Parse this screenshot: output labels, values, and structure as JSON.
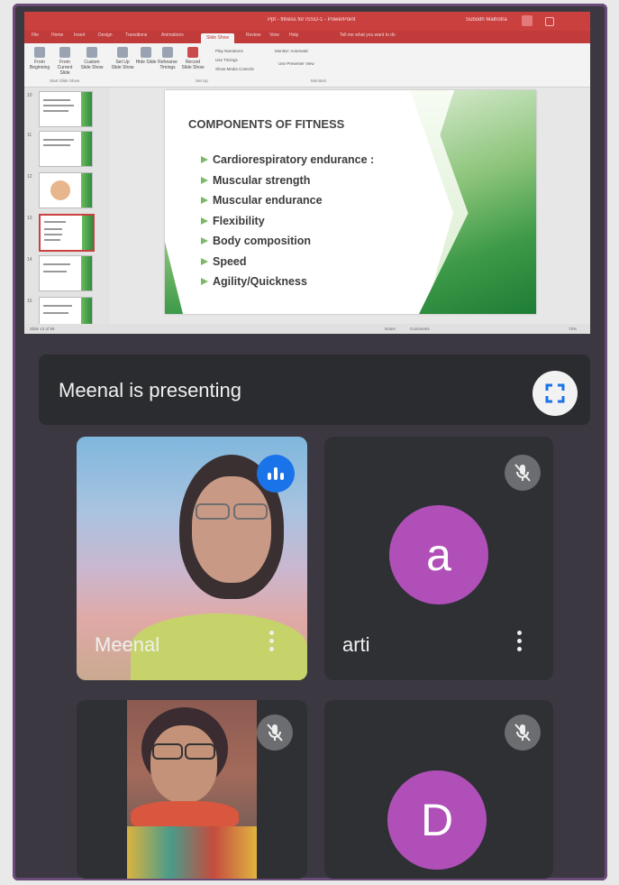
{
  "app": {
    "title": "Ppt - fitness for ISSD-1 - PowerPoint",
    "user": "Subodh Malhotra"
  },
  "ribbon": {
    "tabs": [
      "File",
      "Home",
      "Insert",
      "Design",
      "Transitions",
      "Animations",
      "Slide Show",
      "Review",
      "View",
      "Help",
      "Tell me what you want to do"
    ],
    "active_tab": "Slide Show",
    "buttons": [
      "From Beginning",
      "From Current Slide",
      "Custom Slide Show",
      "Set Up Slide Show",
      "Hide Slide",
      "Rehearse Timings",
      "Record Slide Show"
    ],
    "options": [
      "Play Narrations",
      "Use Timings",
      "Show Media Controls"
    ],
    "monitor_label": "Monitor: Automatic",
    "presenter_view": "Use Presenter View",
    "groups": [
      "Start Slide Show",
      "Set Up",
      "Monitors"
    ]
  },
  "thumbnails": [
    {
      "num": "10"
    },
    {
      "num": "11"
    },
    {
      "num": "12"
    },
    {
      "num": "13",
      "selected": true
    },
    {
      "num": "14"
    },
    {
      "num": "15"
    }
  ],
  "slide": {
    "title": "COMPONENTS OF FITNESS",
    "bullets": [
      "Cardiorespiratory  endurance :",
      "Muscular strength",
      "Muscular endurance",
      "Flexibility",
      "Body composition",
      "Speed",
      "Agility/Quickness"
    ],
    "accent": "#3d9a48"
  },
  "statusbar": {
    "slide_count": "Slide 13 of 58",
    "notes": "Notes",
    "comments": "Comments",
    "zoom": "72%"
  },
  "meet": {
    "presenting_text": "Meenal is presenting",
    "fullscreen_icon": "fullscreen-icon",
    "participants": [
      {
        "name": "Meenal",
        "speaking": true,
        "video": true
      },
      {
        "name": "arti",
        "initial": "a",
        "muted": true
      },
      {
        "name": "",
        "video": true,
        "muted": true
      },
      {
        "name": "",
        "initial": "D",
        "muted": true
      }
    ],
    "colors": {
      "avatar": "#b04fb8",
      "speaking": "#1a73e8",
      "tile": "#2f3034"
    }
  }
}
